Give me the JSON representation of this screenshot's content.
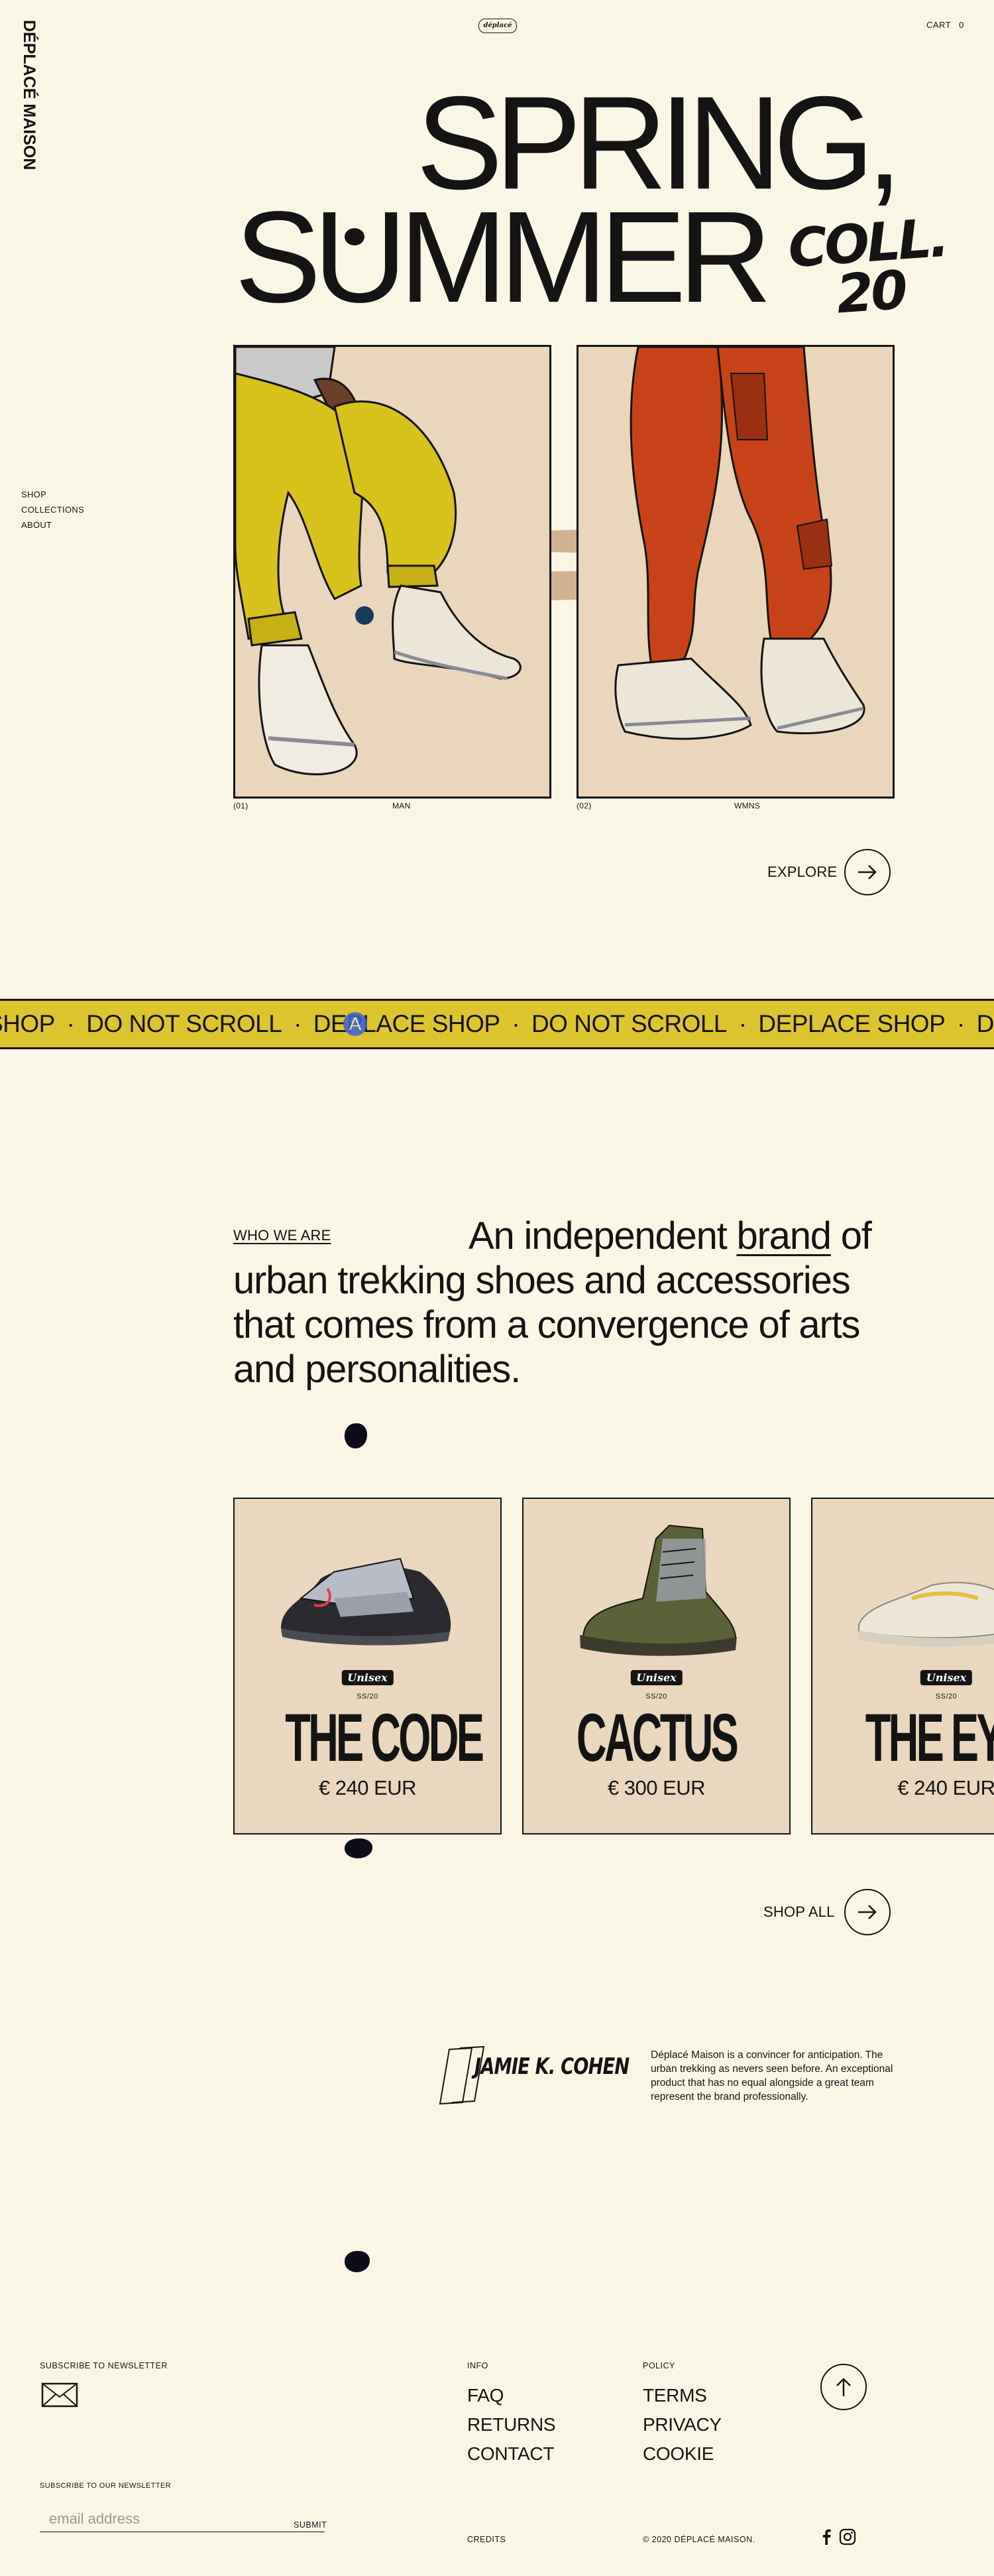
{
  "brand": {
    "logo": "DÉPLACÉ MAISON",
    "badge": "déplacé"
  },
  "header": {
    "cart_label": "CART",
    "cart_count": "0"
  },
  "side_nav": [
    {
      "label": "SHOP"
    },
    {
      "label": "COLLECTIONS"
    },
    {
      "label": "ABOUT"
    }
  ],
  "hero": {
    "line1": "SPRING,",
    "line2": "SUMMER",
    "collection_l1": "COLL.",
    "collection_l2": "20",
    "panels": [
      {
        "index": "(01)",
        "label": "MAN"
      },
      {
        "index": "(02)",
        "label": "WMNS"
      }
    ],
    "explore_label": "EXPLORE"
  },
  "marquee": {
    "items": [
      "SHOP",
      "DO NOT SCROLL",
      "DEPLACE SHOP",
      "DO NOT SCROLL",
      "DEPLACE SHOP",
      "DO NOT SCROLL"
    ],
    "separator": "·"
  },
  "cursor": {
    "letter": "A"
  },
  "about": {
    "label": "WHO WE ARE",
    "statement_pre": "An independent ",
    "statement_link": "brand",
    "statement_post": " of urban trekking shoes and accessories that comes from a convergence of arts and personalities."
  },
  "products": [
    {
      "tag": "Unisex",
      "season": "SS/20",
      "name": "THE CODE",
      "price": "€ 240 EUR"
    },
    {
      "tag": "Unisex",
      "season": "SS/20",
      "name": "CACTUS",
      "price": "€ 300 EUR"
    },
    {
      "tag": "Unisex",
      "season": "SS/20",
      "name": "THE EYE",
      "price": "€ 240 EUR"
    }
  ],
  "shop_all_label": "SHOP ALL",
  "founder": {
    "signature": "JAMIE K. COHEN",
    "quote": "Déplacé Maison is a convincer for anticipation. The urban trekking as nevers seen before. An exceptional product that has no equal alongside a great team represent the brand professionally."
  },
  "footer": {
    "newsletter_title": "SUBSCRIBE TO NEWSLETTER",
    "newsletter_sub": "SUBSCRIBE TO OUR NEWSLETTER",
    "email_placeholder": "email address",
    "submit_label": "SUBMIT",
    "info_title": "INFO",
    "info_links": [
      {
        "label": "FAQ"
      },
      {
        "label": "RETURNS"
      },
      {
        "label": "CONTACT"
      }
    ],
    "policy_title": "POLICY",
    "policy_links": [
      {
        "label": "TERMS"
      },
      {
        "label": "PRIVACY"
      },
      {
        "label": "COOKIE"
      }
    ],
    "credits": "CREDITS",
    "copyright": "© 2020 DÉPLACÉ MAISON."
  },
  "colors": {
    "background": "#faf6e6",
    "marquee": "#dcc52e",
    "ink": "#141414",
    "card": "#ead7bf",
    "cursor": "#3a5fd8"
  },
  "icons": [
    "arrow-right-icon",
    "arrow-up-icon",
    "envelope-icon",
    "facebook-icon",
    "instagram-icon"
  ]
}
